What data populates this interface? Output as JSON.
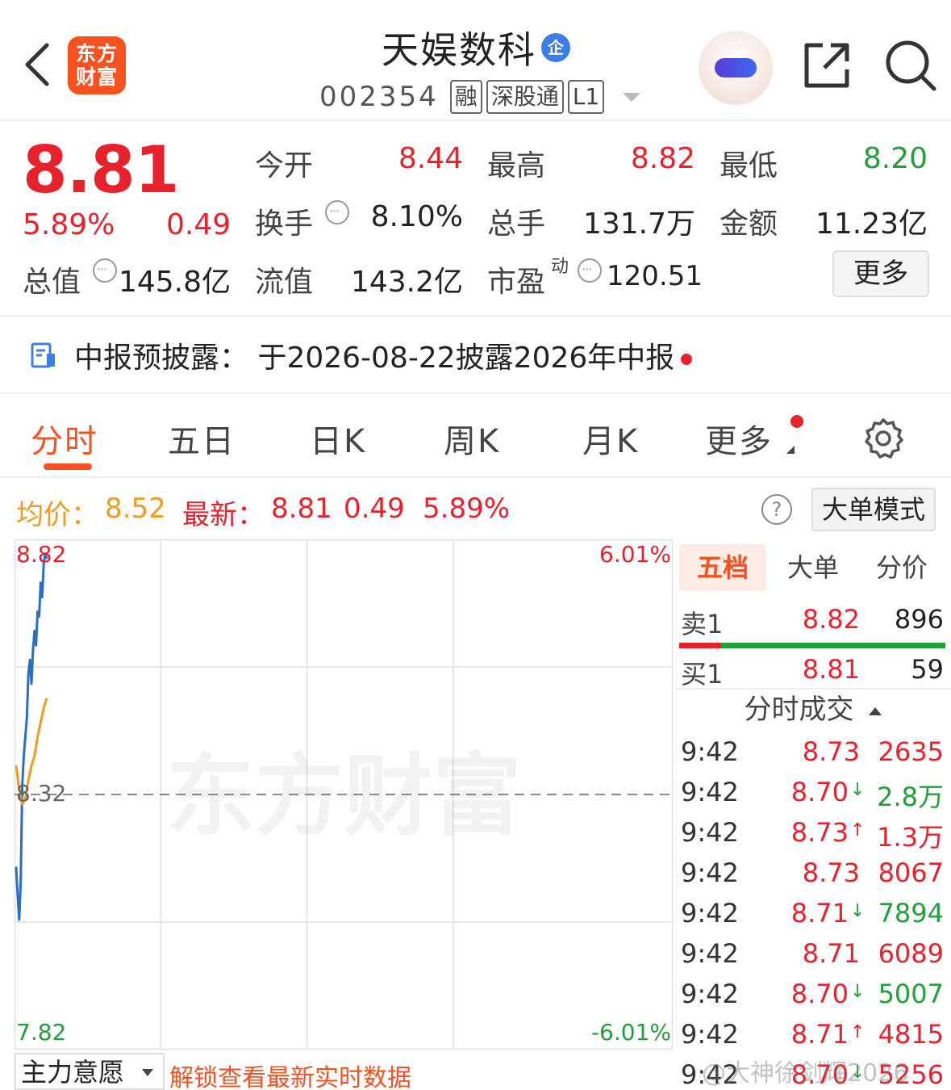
{
  "header": {
    "logo_text": "东方财富",
    "stock_name": "天娱数科",
    "ent_badge": "企",
    "stock_code": "002354",
    "tags": [
      "融",
      "深股通",
      "L1"
    ]
  },
  "quote": {
    "price": "8.81",
    "change_pct": "5.89%",
    "change": "0.49",
    "open_label": "今开",
    "open": "8.44",
    "high_label": "最高",
    "high": "8.82",
    "low_label": "最低",
    "low": "8.20",
    "turnover_label": "换手",
    "turnover": "8.10%",
    "volume_label": "总手",
    "volume": "131.7万",
    "amount_label": "金额",
    "amount": "11.23亿",
    "mktcap_label": "总值",
    "mktcap": "145.8亿",
    "float_label": "流值",
    "float_cap": "143.2亿",
    "pe_label": "市盈",
    "pe_sup": "动",
    "pe": "120.51",
    "more_label": "更多"
  },
  "notice": {
    "text": "中报预披露：  于2026-08-22披露2026年中报"
  },
  "tabs": [
    {
      "label": "分时",
      "active": true
    },
    {
      "label": "五日"
    },
    {
      "label": "日K"
    },
    {
      "label": "周K"
    },
    {
      "label": "月K"
    },
    {
      "label": "更多"
    }
  ],
  "summary": {
    "avg_label": "均价：",
    "avg": "8.52",
    "latest_label": "最新：",
    "latest": "8.81",
    "latest_change": "0.49",
    "latest_pct": "5.89%",
    "help_symbol": "?",
    "big_order_mode": "大单模式"
  },
  "chart_data": {
    "type": "line",
    "y_top_label": "8.82",
    "y_mid_label": "8.32",
    "y_bottom_label": "7.82",
    "pct_top_label": "6.01%",
    "pct_bottom_label": "-6.01%",
    "ylim": [
      7.82,
      8.82
    ],
    "prev_close": 8.32,
    "watermark": "东方财富",
    "series": [
      {
        "color": "#2a6fc1",
        "x": [
          0,
          1,
          2,
          3,
          4,
          5,
          6,
          7,
          8,
          9,
          10,
          11,
          12,
          13,
          14,
          15,
          16,
          17,
          18,
          19,
          20
        ],
        "values": [
          8.17,
          8.11,
          8.06,
          8.14,
          8.34,
          8.4,
          8.44,
          8.48,
          8.57,
          8.6,
          8.55,
          8.62,
          8.66,
          8.63,
          8.7,
          8.69,
          8.76,
          8.73,
          8.8,
          8.82,
          8.81
        ]
      },
      {
        "color": "#f19a1f",
        "x": [
          0,
          2,
          4,
          6,
          8,
          10,
          12,
          14,
          16,
          18,
          20
        ],
        "values": [
          8.38,
          8.33,
          8.3,
          8.31,
          8.35,
          8.38,
          8.4,
          8.44,
          8.47,
          8.5,
          8.52
        ]
      }
    ]
  },
  "order_panel": {
    "tabs": [
      "五档",
      "大单",
      "分价"
    ],
    "sell1_label": "卖1",
    "sell1_price": "8.82",
    "sell1_vol": "896",
    "buy1_label": "买1",
    "buy1_price": "8.81",
    "buy1_vol": "59",
    "trades_header": "分时成交",
    "trades": [
      {
        "time": "9:42",
        "price": "8.73",
        "arrow": "",
        "vol": "2635",
        "vol_color": "red"
      },
      {
        "time": "9:42",
        "price": "8.70",
        "arrow": "↓",
        "vol": "2.8万",
        "vol_color": "green"
      },
      {
        "time": "9:42",
        "price": "8.73",
        "arrow": "↑",
        "vol": "1.3万",
        "vol_color": "red"
      },
      {
        "time": "9:42",
        "price": "8.73",
        "arrow": "",
        "vol": "8067",
        "vol_color": "red"
      },
      {
        "time": "9:42",
        "price": "8.71",
        "arrow": "↓",
        "vol": "7894",
        "vol_color": "green"
      },
      {
        "time": "9:42",
        "price": "8.71",
        "arrow": "",
        "vol": "6089",
        "vol_color": "red"
      },
      {
        "time": "9:42",
        "price": "8.70",
        "arrow": "↓",
        "vol": "5007",
        "vol_color": "green"
      },
      {
        "time": "9:42",
        "price": "8.71",
        "arrow": "↑",
        "vol": "4815",
        "vol_color": "red"
      },
      {
        "time": "9:42",
        "price": "8.70",
        "arrow": "↓",
        "vol": "5256",
        "vol_color": "red"
      }
    ]
  },
  "bottom": {
    "flow_select": "主力意愿",
    "unlock_text": "解锁查看最新实时数据",
    "watermark": "@大神徐剑辉2026"
  },
  "colors": {
    "accent": "#f5521f",
    "up": "#e8222d",
    "down": "#21a03a",
    "price_line": "#2a6fc1",
    "avg_line": "#f19a1f"
  }
}
